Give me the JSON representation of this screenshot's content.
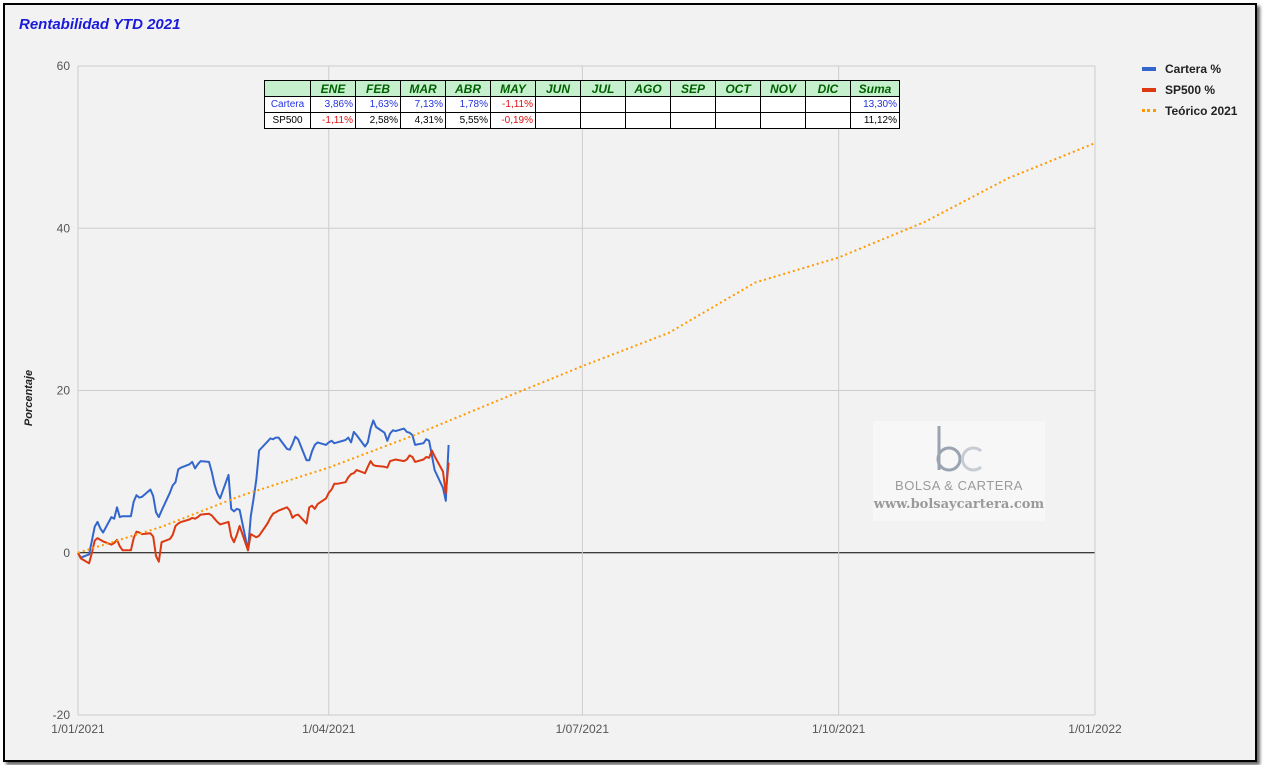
{
  "chart_data": {
    "type": "line",
    "title": "Rentabilidad YTD 2021",
    "ylabel": "Porcentaje",
    "xlabel": "",
    "ylim": [
      -20,
      60
    ],
    "yticks": [
      "60",
      "40",
      "20",
      "0",
      "-20"
    ],
    "xticks": [
      "1/01/2021",
      "1/04/2021",
      "1/07/2021",
      "1/10/2021",
      "1/01/2022"
    ],
    "xticks_days": [
      0,
      90,
      181,
      273,
      365
    ],
    "xlim_days": [
      0,
      365
    ],
    "legend_position": "right",
    "grid": true,
    "series": [
      {
        "name": "Cartera %",
        "color": "#3366cc",
        "x_days": [
          0,
          1,
          4,
          5,
          6,
          7,
          8,
          9,
          12,
          13,
          14,
          15,
          16,
          19,
          20,
          21,
          22,
          23,
          26,
          27,
          28,
          29,
          30,
          33,
          34,
          35,
          36,
          37,
          40,
          41,
          42,
          43,
          44,
          47,
          48,
          49,
          50,
          51,
          54,
          55,
          56,
          57,
          58,
          61,
          62,
          63,
          64,
          65,
          68,
          69,
          70,
          71,
          72,
          75,
          76,
          77,
          78,
          79,
          82,
          83,
          84,
          85,
          86,
          89,
          90,
          91,
          92,
          93,
          96,
          97,
          98,
          99,
          100,
          103,
          104,
          105,
          106,
          107,
          110,
          111,
          112,
          113,
          114,
          117,
          118,
          119,
          120,
          121,
          124,
          125,
          126,
          127,
          128,
          131,
          132,
          133
        ],
        "values": [
          0,
          -0.6,
          -0.2,
          1.5,
          3.2,
          3.8,
          3.0,
          2.5,
          4.4,
          4.2,
          5.6,
          4.4,
          4.5,
          4.5,
          6.3,
          7.1,
          6.8,
          6.9,
          7.8,
          7.0,
          5.0,
          4.4,
          5.2,
          7.4,
          8.3,
          8.7,
          10.3,
          10.5,
          10.9,
          11.2,
          10.4,
          10.9,
          11.3,
          11.2,
          10.0,
          8.4,
          7.3,
          6.7,
          9.6,
          5.4,
          5.1,
          5.4,
          5.3,
          0.3,
          4.5,
          6.6,
          9.0,
          12.6,
          13.7,
          14.1,
          14.0,
          14.2,
          14.2,
          12.8,
          12.7,
          13.4,
          14.3,
          14.0,
          11.4,
          11.4,
          12.5,
          13.3,
          13.6,
          13.3,
          13.6,
          13.8,
          13.5,
          13.6,
          13.9,
          14.2,
          13.6,
          14.9,
          14.5,
          13.1,
          13.6,
          15.3,
          16.3,
          15.5,
          14.8,
          13.8,
          14.7,
          15.1,
          15.0,
          15.3,
          14.9,
          14.8,
          14.5,
          13.3,
          13.5,
          14.0,
          13.8,
          12.0,
          10.2,
          8.0,
          6.4,
          13.3
        ]
      },
      {
        "name": "SP500 %",
        "color": "#dc3912",
        "x_days": [
          0,
          1,
          4,
          5,
          6,
          7,
          8,
          9,
          12,
          13,
          14,
          15,
          16,
          19,
          20,
          21,
          22,
          23,
          26,
          27,
          28,
          29,
          30,
          33,
          34,
          35,
          36,
          37,
          40,
          41,
          42,
          43,
          44,
          47,
          48,
          49,
          50,
          51,
          54,
          55,
          56,
          57,
          58,
          61,
          62,
          63,
          64,
          65,
          68,
          69,
          70,
          71,
          72,
          75,
          76,
          77,
          78,
          79,
          82,
          83,
          84,
          85,
          86,
          89,
          90,
          91,
          92,
          93,
          96,
          97,
          98,
          99,
          100,
          103,
          104,
          105,
          106,
          107,
          110,
          111,
          112,
          113,
          114,
          117,
          118,
          119,
          120,
          121,
          124,
          125,
          126,
          127,
          128,
          131,
          132,
          133
        ],
        "values": [
          0,
          -0.7,
          -1.3,
          0,
          1.5,
          1.8,
          1.6,
          1.4,
          1.0,
          1.2,
          1.6,
          0.8,
          0.3,
          0.3,
          1.8,
          2.6,
          2.5,
          2.3,
          2.4,
          2.0,
          -0.4,
          -1.1,
          1.3,
          1.7,
          2.2,
          3.3,
          3.6,
          3.8,
          4.1,
          4.3,
          4.2,
          4.4,
          4.7,
          4.8,
          4.6,
          4.2,
          3.8,
          3.5,
          3.8,
          2.0,
          1.3,
          2.2,
          3.3,
          0.3,
          2.3,
          2.1,
          1.9,
          2.1,
          3.6,
          4.3,
          4.8,
          5.0,
          5.2,
          5.6,
          5.2,
          4.3,
          4.6,
          4.7,
          3.6,
          5.6,
          5.8,
          5.4,
          6.0,
          6.7,
          7.4,
          7.8,
          8.5,
          8.5,
          8.7,
          9.3,
          9.7,
          9.8,
          10.2,
          9.8,
          10.6,
          11.3,
          10.8,
          10.7,
          10.6,
          10.5,
          11.3,
          11.4,
          11.5,
          11.3,
          11.5,
          12.0,
          11.8,
          11.2,
          11.5,
          11.8,
          11.7,
          12.6,
          11.9,
          10.0,
          7.3,
          11.1
        ]
      },
      {
        "name": "Teórico 2021",
        "color": "#ff9900",
        "style": "dotted",
        "x_days": [
          0,
          30,
          59,
          90,
          120,
          151,
          181,
          212,
          243,
          273,
          304,
          334,
          365
        ],
        "values": [
          0,
          3.2,
          7.1,
          10.5,
          14.4,
          18.8,
          23.0,
          27.1,
          33.3,
          36.4,
          40.8,
          46.2,
          50.5
        ]
      }
    ]
  },
  "monthly_table": {
    "headers": [
      "",
      "ENE",
      "FEB",
      "MAR",
      "ABR",
      "MAY",
      "JUN",
      "JUL",
      "AGO",
      "SEP",
      "OCT",
      "NOV",
      "DIC",
      "Suma"
    ],
    "rows": [
      {
        "label": "Cartera",
        "color": "blue",
        "cells": [
          "3,86%",
          "1,63%",
          "7,13%",
          "1,78%",
          "-1,11%",
          "",
          "",
          "",
          "",
          "",
          "",
          "",
          "13,30%"
        ],
        "cell_colors": [
          "blue",
          "blue",
          "blue",
          "blue",
          "red",
          "",
          "",
          "",
          "",
          "",
          "",
          "",
          "blue"
        ]
      },
      {
        "label": "SP500",
        "color": "black",
        "cells": [
          "-1,11%",
          "2,58%",
          "4,31%",
          "5,55%",
          "-0,19%",
          "",
          "",
          "",
          "",
          "",
          "",
          "",
          "11,12%"
        ],
        "cell_colors": [
          "red",
          "black",
          "black",
          "black",
          "red",
          "",
          "",
          "",
          "",
          "",
          "",
          "",
          "black"
        ]
      }
    ]
  },
  "watermark": {
    "logo_text": "bc",
    "brand": "BOLSA & CARTERA",
    "url": "www.bolsaycartera.com"
  }
}
